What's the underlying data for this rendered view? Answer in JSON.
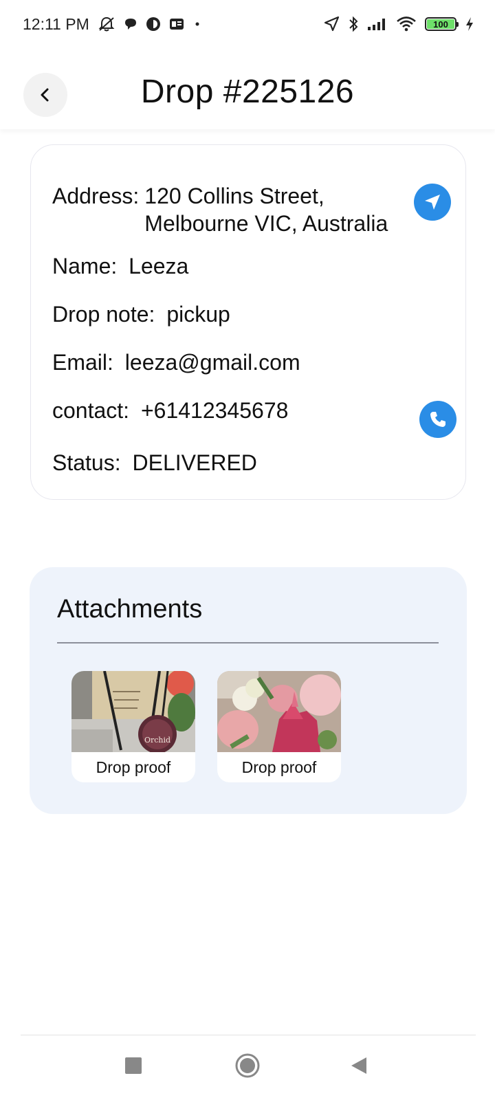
{
  "status_bar": {
    "time": "12:11 PM",
    "battery": "100",
    "left_icons": [
      "muted-alarm-icon",
      "chat-bubble-icon",
      "circle-app-icon",
      "card-icon",
      "dot-icon"
    ],
    "right_icons": [
      "location-arrow-icon",
      "bluetooth-icon",
      "signal-icon",
      "wifi-icon",
      "battery-icon",
      "charging-bolt-icon"
    ]
  },
  "header": {
    "title": "Drop #225126",
    "back_icon": "chevron-left-icon"
  },
  "details": {
    "address_label": "Address:",
    "address_line1": "120 Collins Street,",
    "address_line2": "Melbourne VIC, Australia",
    "name_label": "Name:",
    "name_value": "Leeza",
    "note_label": "Drop note:",
    "note_value": "pickup",
    "email_label": "Email:",
    "email_value": "leeza@gmail.com",
    "contact_label": "contact:",
    "contact_value": "+61412345678",
    "status_label": "Status:",
    "status_value": "DELIVERED",
    "navigate_icon": "navigation-arrow-icon",
    "call_icon": "phone-icon"
  },
  "attachments": {
    "title": "Attachments",
    "items": [
      {
        "label": "Drop proof",
        "image": "Orchid"
      },
      {
        "label": "Drop proof",
        "image": ""
      }
    ]
  },
  "navbar": {
    "icons": [
      "recents-square-icon",
      "home-circle-icon",
      "back-triangle-icon"
    ]
  },
  "colors": {
    "accent": "#2a8de6",
    "attachments_bg": "#eef3fb",
    "battery_green": "#6ee06a"
  }
}
